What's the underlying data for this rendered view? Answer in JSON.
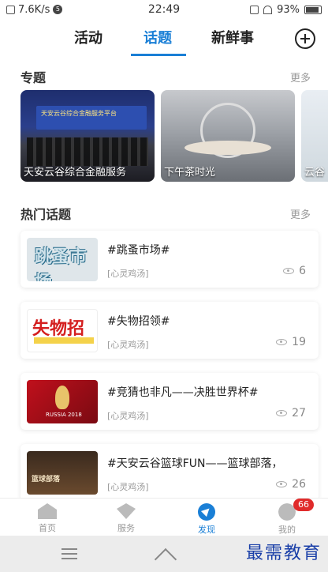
{
  "status_bar": {
    "speed": "7.6K/s",
    "notif": "5",
    "time": "22:49",
    "battery": "93%"
  },
  "tabs": [
    {
      "label": "活动"
    },
    {
      "label": "话题"
    },
    {
      "label": "新鲜事"
    }
  ],
  "topics_section": {
    "title": "专题",
    "more": "更多",
    "cards": [
      {
        "caption": "天安云谷综合金融服务",
        "banner": "天安云谷综合金融服务平台"
      },
      {
        "caption": "下午茶时光"
      },
      {
        "caption": "云谷"
      }
    ]
  },
  "hot_section": {
    "title": "热门话题",
    "more": "更多",
    "items": [
      {
        "title": "#跳蚤市场#",
        "tag": "[心灵鸡汤]",
        "views": "6",
        "thumb_text": "跳蚤市场"
      },
      {
        "title": "#失物招领#",
        "tag": "[心灵鸡汤]",
        "views": "19",
        "thumb_text": "失物招"
      },
      {
        "title": "#竞猜也非凡——决胜世界杯#",
        "tag": "[心灵鸡汤]",
        "views": "27",
        "thumb_text": "RUSSIA 2018"
      },
      {
        "title": "#天安云谷篮球FUN——篮球部落，",
        "tag": "[心灵鸡汤]",
        "views": "26",
        "thumb_text": "篮球部落"
      }
    ]
  },
  "bottom_nav": [
    {
      "label": "首页",
      "icon": "home-icon"
    },
    {
      "label": "服务",
      "icon": "service-icon"
    },
    {
      "label": "发现",
      "icon": "discover-icon"
    },
    {
      "label": "我的",
      "icon": "user-icon",
      "badge": "66"
    }
  ],
  "watermark": "最需教育",
  "colors": {
    "accent": "#1a7fd6",
    "badge": "#e02b2b"
  }
}
